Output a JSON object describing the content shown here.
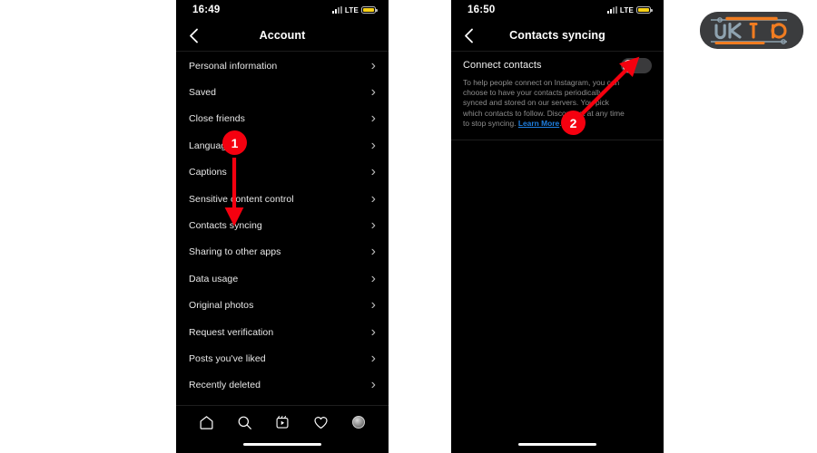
{
  "page": {
    "background": "#ffffff",
    "accent_red": "#f5000f",
    "link_blue": "#1f7fe0",
    "battery_yellow": "#f7d117"
  },
  "watermark": {
    "name": "uk19-logo",
    "text": "UK19",
    "gray_color": "#8fa3b0",
    "orange_color": "#f07c21",
    "plate_color": "#3b3c3e"
  },
  "left_phone": {
    "status": {
      "time": "16:49",
      "network": "LTE",
      "signal_icon": "signal-bars-icon",
      "battery_icon": "battery-low-power-icon"
    },
    "nav": {
      "back_icon": "chevron-left-icon",
      "title": "Account"
    },
    "items": [
      {
        "label": "Personal information",
        "chevron": "›"
      },
      {
        "label": "Saved",
        "chevron": "›"
      },
      {
        "label": "Close friends",
        "chevron": "›"
      },
      {
        "label": "Language",
        "chevron": "›"
      },
      {
        "label": "Captions",
        "chevron": "›"
      },
      {
        "label": "Sensitive content control",
        "chevron": "›"
      },
      {
        "label": "Contacts syncing",
        "chevron": "›"
      },
      {
        "label": "Sharing to other apps",
        "chevron": "›"
      },
      {
        "label": "Data usage",
        "chevron": "›"
      },
      {
        "label": "Original photos",
        "chevron": "›"
      },
      {
        "label": "Request verification",
        "chevron": "›"
      },
      {
        "label": "Posts you've liked",
        "chevron": "›"
      },
      {
        "label": "Recently deleted",
        "chevron": "›"
      }
    ],
    "tabbar": [
      {
        "name": "tab-home",
        "icon": "home-icon"
      },
      {
        "name": "tab-search",
        "icon": "search-icon"
      },
      {
        "name": "tab-reels",
        "icon": "reels-icon"
      },
      {
        "name": "tab-activity",
        "icon": "heart-icon"
      },
      {
        "name": "tab-profile",
        "icon": "avatar-icon"
      }
    ]
  },
  "right_phone": {
    "status": {
      "time": "16:50",
      "network": "LTE",
      "signal_icon": "signal-bars-icon",
      "battery_icon": "battery-low-power-icon"
    },
    "nav": {
      "back_icon": "chevron-left-icon",
      "title": "Contacts syncing"
    },
    "connect": {
      "title": "Connect contacts",
      "toggle_state": "off",
      "description": "To help people connect on Instagram, you can choose to have your contacts periodically synced and stored on our servers. You pick which contacts to follow. Disconnect at any time to stop syncing. ",
      "learn_more": "Learn More",
      "description_end": "."
    }
  },
  "annotations": [
    {
      "name": "step-badge-1",
      "label": "1",
      "target": "Contacts syncing list item"
    },
    {
      "name": "step-badge-2",
      "label": "2",
      "target": "Connect contacts toggle"
    }
  ]
}
